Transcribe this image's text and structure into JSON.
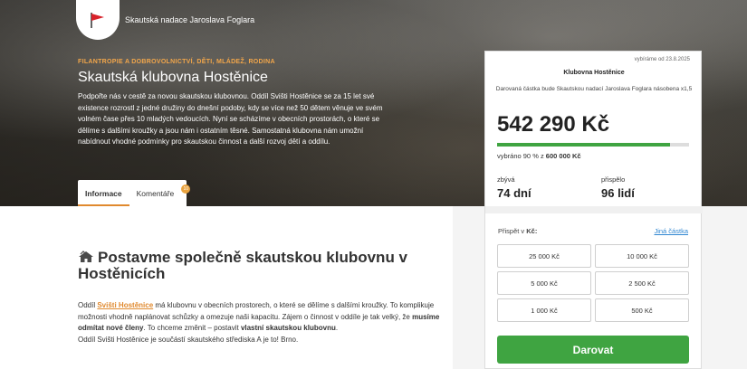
{
  "header": {
    "org_name": "Skautská nadace Jaroslava Foglara",
    "kicker": "FILANTROPIE A DOBROVOLNICTVÍ, DĚTI, MLÁDEŽ, RODINA",
    "title": "Skautská klubovna Hostěnice",
    "description": "Podpořte nás v cestě za novou skautskou klubovnou. Oddíl Svišti Hostěnice se za 15 let své existence rozrostl z jedné družiny do dnešní podoby, kdy se více než 50 dětem věnuje ve svém volném čase přes 10 mladých vedoucích. Nyní se scházíme v obecních prostorách, o které se dělíme s dalšími kroužky a jsou nám i ostatním těsné. Samostatná klubovna nám umožní nabídnout vhodné podmínky pro skautskou činnost a další rozvoj dětí a oddílu."
  },
  "tabs": [
    {
      "label": "Informace"
    },
    {
      "label": "Komentáře",
      "badge": "10"
    }
  ],
  "section": {
    "title": "Postavme společně skautskou klubovnu v Hostěnicích",
    "p1_a": "Oddíl ",
    "p1_link": "Svišti Hostěnice",
    "p1_b": " má klubovnu v obecních prostorech, o které se dělíme s dalšími kroužky. To komplikuje možnosti vhodně naplánovat schůzky a omezuje naši kapacitu. Zájem o činnost v oddíle je tak velký, že ",
    "p1_bold1": "musíme odmítat nové členy",
    "p1_c": ". To chceme změnit – postavit ",
    "p1_bold2": "vlastní skautskou klubovnu",
    "p1_d": ".",
    "p2": "Oddíl Svišti Hostěnice je součástí skautského střediska A je to! Brno."
  },
  "card": {
    "date": "vybíráme od 23.8.2025",
    "name": "Klubovna Hostěnice",
    "note": "Darovaná částka bude Skautskou nadací Jaroslava Foglara násobena x1,5",
    "amount": "542 290 Kč",
    "progress_fraction": 0.9,
    "progress_prefix": "vybráno 90 % z",
    "progress_goal": "600 000 Kč",
    "remaining_label": "zbývá",
    "remaining_value": "74 dní",
    "donors_label": "přispělo",
    "donors_value": "96 lidí"
  },
  "panel": {
    "label_prefix": "Přispět v ",
    "label_currency": "Kč:",
    "other_amount": "Jiná částka",
    "amounts": [
      "25 000 Kč",
      "10 000 Kč",
      "5 000 Kč",
      "2 500 Kč",
      "1 000 Kč",
      "500 Kč"
    ],
    "donate": "Darovat"
  },
  "colors": {
    "accent": "#e0892e",
    "success": "#3fa441",
    "link": "#2f86d1"
  }
}
